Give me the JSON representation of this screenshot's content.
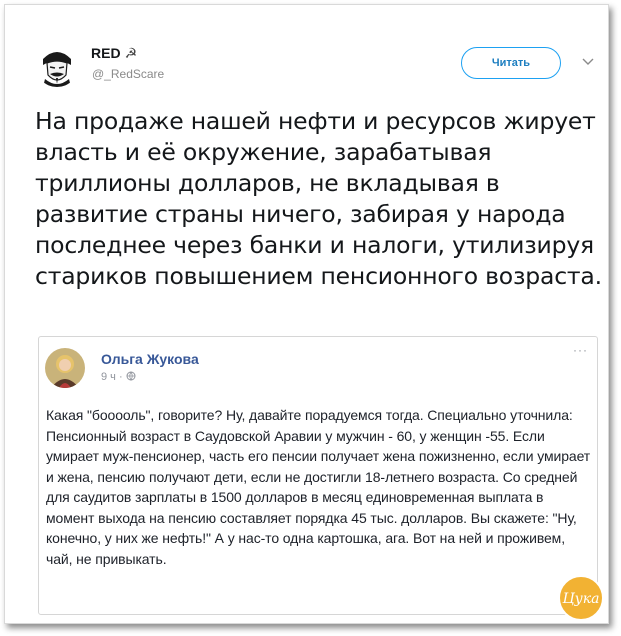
{
  "tweet": {
    "author_name": "RED",
    "author_badge": "☭",
    "author_handle": "@_RedScare",
    "follow_label": "Читать",
    "text": "На продаже нашей нефти и ресурсов жирует власть и её окружение, зарабатывая триллионы долларов, не вкладывая в развитие страны ничего, забирая у народа последнее через банки и налоги, утилизируя стариков повышением пенсионного возраста."
  },
  "quote": {
    "author_name": "Ольга Жукова",
    "meta": "9 ч · ",
    "more": "···",
    "text": "Какая \"бооооль\", говорите? Ну, давайте порадуемся тогда. Специально уточнила: Пенсионный возраст в Саудовской Аравии у мужчин - 60, у женщин -55. Если умирает муж-пенсионер, часть его пенсии получает жена пожизненно, если умирает и жена, пенсию получают дети, если не достигли 18-летнего возраста. Со средней для саудитов зарплаты в 1500 долларов в месяц единовременная выплата в момент выхода на пенсию составляет порядка 45 тыс. долларов. Вы скажете: \"Ну, конечно, у них же нефть!\" А у нас-то одна картошка, ага. Вот на ней и проживем, чай, не привыкать."
  },
  "watermark": {
    "label": "Цука"
  },
  "colors": {
    "accent": "#1da1f2",
    "fb_blue": "#385898",
    "watermark": "#f2b233"
  },
  "icons": [
    "avatar-mask-icon",
    "chevron-down-icon",
    "globe-icon"
  ]
}
